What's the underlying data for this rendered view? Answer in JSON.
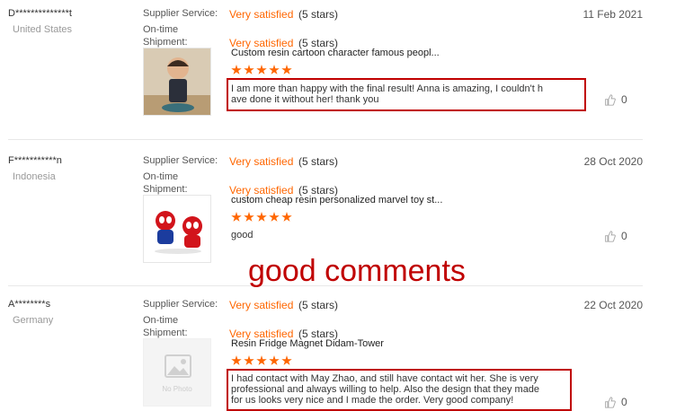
{
  "reviews": [
    {
      "user": "D**************t",
      "country": "United States",
      "supplier_label": "Supplier Service:",
      "supplier_rating": "Very satisfied",
      "supplier_stars": "(5 stars)",
      "ontime_label": "On-time",
      "shipment_label": "Shipment:",
      "shipment_rating": "Very satisfied",
      "shipment_stars": "(5 stars)",
      "date": "11 Feb 2021",
      "product": "Custom resin cartoon character famous peopl...",
      "product_rating": 5,
      "comment_lines": [
        "I am more than happy with the final result! Anna is amazing, I couldn't h",
        "ave done it without her! thank you"
      ],
      "likes": "0",
      "thumb_icon": "bobblehead-figure-photo"
    },
    {
      "user": "F***********n",
      "country": "Indonesia",
      "supplier_label": "Supplier Service:",
      "supplier_rating": "Very satisfied",
      "supplier_stars": "(5 stars)",
      "ontime_label": "On-time",
      "shipment_label": "Shipment:",
      "shipment_rating": "Very satisfied",
      "shipment_stars": "(5 stars)",
      "date": "28 Oct 2020",
      "product": "custom cheap resin personalized marvel toy st...",
      "product_rating": 5,
      "comment_lines": [
        "good"
      ],
      "likes": "0",
      "thumb_icon": "spiderman-figures-photo"
    },
    {
      "user": "A********s",
      "country": "Germany",
      "supplier_label": "Supplier Service:",
      "supplier_rating": "Very satisfied",
      "supplier_stars": "(5 stars)",
      "ontime_label": "On-time",
      "shipment_label": "Shipment:",
      "shipment_rating": "Very satisfied",
      "shipment_stars": "(5 stars)",
      "date": "22 Oct 2020",
      "product": "Resin Fridge Magnet Didam-Tower",
      "product_rating": 5,
      "comment_lines": [
        "I had contact with May Zhao, and still have contact wit her. She is very",
        "professional and always willing to help. Also the design that they made",
        "for us looks very nice and I made the order. Very good company!"
      ],
      "likes": "0",
      "thumb_icon": "no-photo-placeholder",
      "no_photo_label": "No Photo"
    }
  ],
  "overlay_text": "good comments",
  "colors": {
    "accent": "#ff6600",
    "highlight": "#c00000",
    "muted": "#999999"
  }
}
